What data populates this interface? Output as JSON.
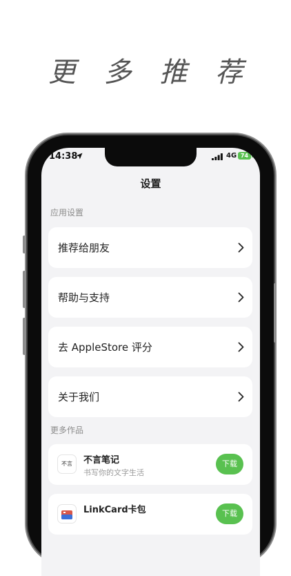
{
  "promo": {
    "headline": "更 多 推 荐"
  },
  "status_bar": {
    "time": "14:38",
    "network": "4G",
    "battery": "74"
  },
  "nav": {
    "title": "设置"
  },
  "app_settings": {
    "section_label": "应用设置",
    "items": [
      {
        "label": "推荐给朋友"
      },
      {
        "label": "帮助与支持"
      },
      {
        "label": "去 AppleStore 评分"
      },
      {
        "label": "关于我们"
      }
    ]
  },
  "more_works": {
    "section_label": "更多作品",
    "apps": [
      {
        "name": "不言笔记",
        "description": "书写你的文字生活",
        "icon_text": "不言",
        "button": "下载"
      },
      {
        "name": "LinkCard卡包",
        "description": "",
        "icon_text": "",
        "button": "下载"
      }
    ]
  },
  "colors": {
    "accent_green": "#59c150",
    "screen_background": "#f3f3f5"
  }
}
